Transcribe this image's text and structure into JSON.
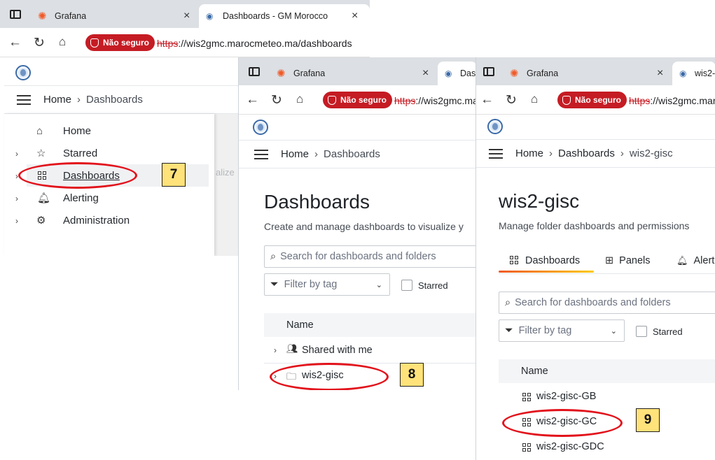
{
  "shot1": {
    "tabs": [
      {
        "title": "Grafana"
      },
      {
        "title": "Dashboards - GM Morocco"
      }
    ],
    "security_label": "Não seguro",
    "url_proto": "https",
    "url_rest": "://wis2gmc.marocmeteo.ma/dashboards",
    "breadcrumb": {
      "home": "Home",
      "current": "Dashboards"
    },
    "menu": [
      {
        "label": "Home",
        "icon": "home-icon"
      },
      {
        "label": "Starred",
        "icon": "star-icon"
      },
      {
        "label": "Dashboards",
        "icon": "grid-icon"
      },
      {
        "label": "Alerting",
        "icon": "bell-icon"
      },
      {
        "label": "Administration",
        "icon": "gear-icon"
      }
    ],
    "faded_text": "alize",
    "step": "7"
  },
  "shot2": {
    "tabs": [
      {
        "title": "Grafana"
      },
      {
        "title": "Dash"
      }
    ],
    "security_label": "Não seguro",
    "url_proto": "https",
    "url_rest": "://wis2gmc.ma",
    "breadcrumb": {
      "home": "Home",
      "current": "Dashboards"
    },
    "title": "Dashboards",
    "subtitle": "Create and manage dashboards to visualize y",
    "search_placeholder": "Search for dashboards and folders",
    "filter_placeholder": "Filter by tag",
    "starred_label": "Starred",
    "table_header": "Name",
    "rows": [
      {
        "label": "Shared with me"
      },
      {
        "label": "wis2-gisc"
      }
    ],
    "step": "8"
  },
  "shot3": {
    "tabs": [
      {
        "title": "Grafana"
      },
      {
        "title": "wis2-g"
      }
    ],
    "security_label": "Não seguro",
    "url_proto": "https",
    "url_rest": "://wis2gmc.mar",
    "breadcrumb": {
      "home": "Home",
      "middle": "Dashboards",
      "current": "wis2-gisc"
    },
    "title": "wis2-gisc",
    "subtitle": "Manage folder dashboards and permissions",
    "tabs_inner": [
      {
        "label": "Dashboards"
      },
      {
        "label": "Panels"
      },
      {
        "label": "Alert"
      }
    ],
    "search_placeholder": "Search for dashboards and folders",
    "filter_placeholder": "Filter by tag",
    "starred_label": "Starred",
    "table_header": "Name",
    "rows": [
      {
        "label": "wis2-gisc-GB"
      },
      {
        "label": "wis2-gisc-GC"
      },
      {
        "label": "wis2-gisc-GDC"
      }
    ],
    "step": "9"
  },
  "colors": {
    "warning_red": "#c51c24",
    "annotation_ring": "#e2121b",
    "badge_fill": "#ffe27a",
    "grafana_orange": "#f05a28"
  }
}
